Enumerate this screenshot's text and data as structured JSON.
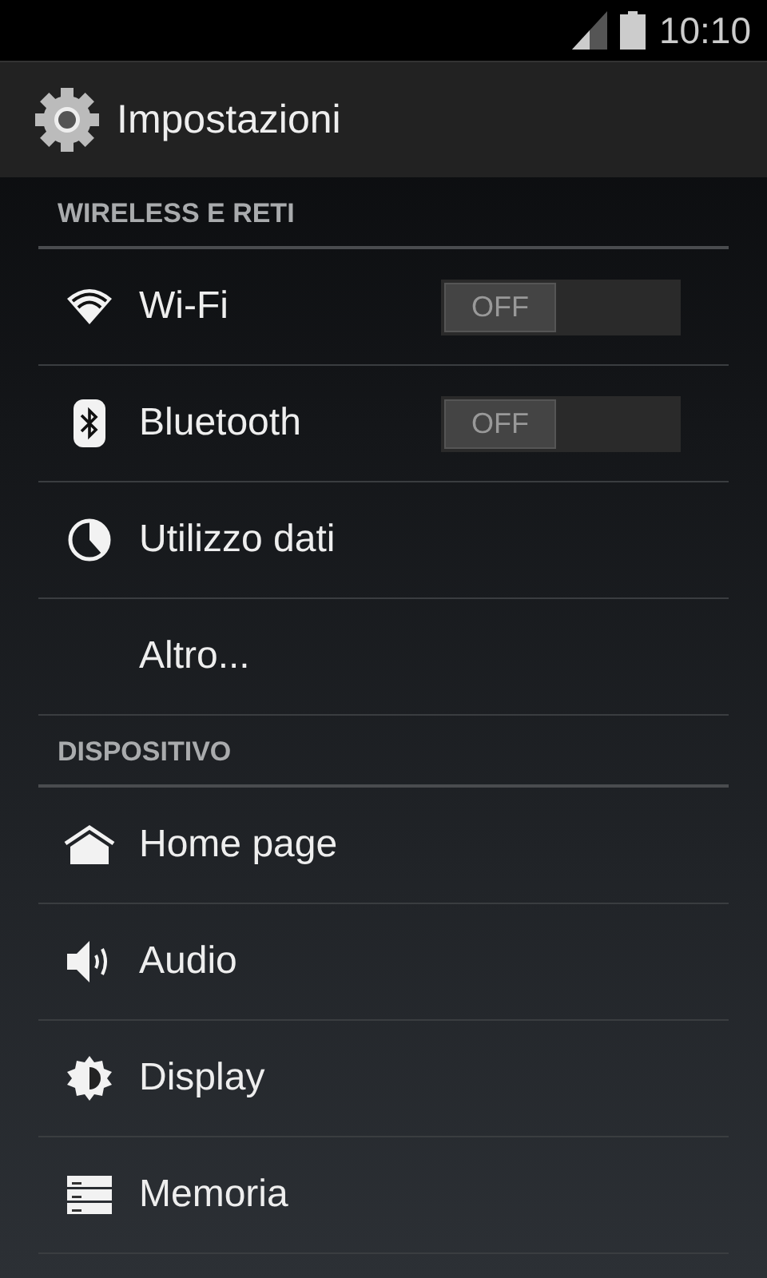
{
  "status_bar": {
    "time": "10:10"
  },
  "action_bar": {
    "title": "Impostazioni"
  },
  "sections": [
    {
      "header": "WIRELESS E RETI",
      "items": [
        {
          "kind": "toggle",
          "label": "Wi-Fi",
          "switch": {
            "on": false,
            "label": "OFF"
          }
        },
        {
          "kind": "toggle",
          "label": "Bluetooth",
          "switch": {
            "on": false,
            "label": "OFF"
          }
        },
        {
          "kind": "plain",
          "label": "Utilizzo dati"
        },
        {
          "kind": "plain",
          "label": "Altro..."
        }
      ]
    },
    {
      "header": "DISPOSITIVO",
      "items": [
        {
          "kind": "plain",
          "label": "Home page"
        },
        {
          "kind": "plain",
          "label": "Audio"
        },
        {
          "kind": "plain",
          "label": "Display"
        },
        {
          "kind": "plain",
          "label": "Memoria"
        }
      ]
    }
  ]
}
